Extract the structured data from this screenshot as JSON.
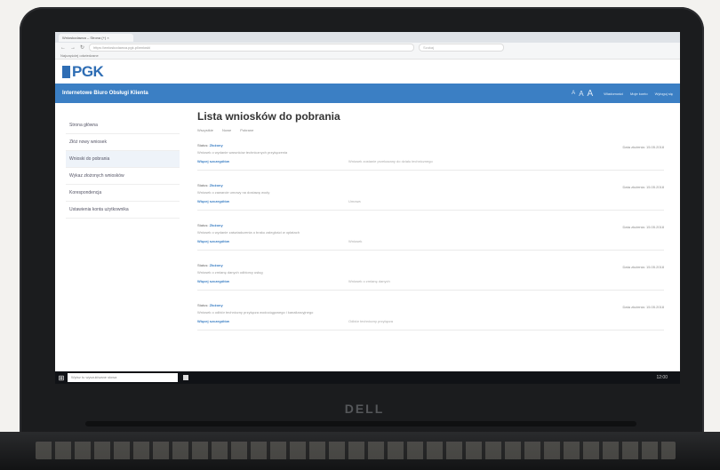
{
  "browser": {
    "tab_title": "Wnioskodawca – Strona (+) ×",
    "url": "https://wnioskodawca.pgk.pl/wnioski",
    "search_placeholder": "Szukaj",
    "bookmarks_label": "Najczęściej odwiedzane"
  },
  "app": {
    "logo": "PGK",
    "header_title": "Internetowe Biuro Obsługi Klienta",
    "font_controls": [
      "A",
      "A",
      "A"
    ],
    "top_links": [
      "Wiadomości",
      "Moje konto",
      "Wyloguj się"
    ]
  },
  "sidebar": {
    "items": [
      {
        "label": "Strona główna"
      },
      {
        "label": "Złóż nowy wniosek"
      },
      {
        "label": "Wnioski do pobrania"
      },
      {
        "label": "Wykaz złożonych wniosków"
      },
      {
        "label": "Korespondencja"
      },
      {
        "label": "Ustawienia konta użytkownika"
      }
    ]
  },
  "main": {
    "title": "Lista wniosków do pobrania",
    "filters": [
      "Wszystkie",
      "Nowe",
      "Pobrane"
    ],
    "rows": [
      {
        "status_label": "Status:",
        "status": "Złożony",
        "date": "Data złożenia: 15.05.2018",
        "description": "Wniosek o wydanie warunków technicznych przyłączenia",
        "link": "Więcej szczegółów",
        "detail": "Wniosek zostanie przekazany do działu technicznego"
      },
      {
        "status_label": "Status:",
        "status": "Złożony",
        "date": "Data złożenia: 15.05.2018",
        "description": "Wniosek o zawarcie umowy na dostawę wody",
        "link": "Więcej szczegółów",
        "detail": "Umowa"
      },
      {
        "status_label": "Status:",
        "status": "Złożony",
        "date": "Data złożenia: 15.05.2018",
        "description": "Wniosek o wydanie zaświadczenia o braku zaległości w opłatach",
        "link": "Więcej szczegółów",
        "detail": "Wniosek"
      },
      {
        "status_label": "Status:",
        "status": "Złożony",
        "date": "Data złożenia: 15.05.2018",
        "description": "Wniosek o zmianę danych odbiorcy usług",
        "link": "Więcej szczegółów",
        "detail": "Wniosek o zmianę danych"
      },
      {
        "status_label": "Status:",
        "status": "Złożony",
        "date": "Data złożenia: 15.05.2018",
        "description": "Wniosek o odbiór techniczny przyłącza wodociągowego i kanalizacyjnego",
        "link": "Więcej szczegółów",
        "detail": "Odbiór techniczny przyłącza"
      }
    ]
  },
  "taskbar": {
    "search_placeholder": "Wpisz tu wyszukiwane słowa",
    "tray": "12:00"
  },
  "device": {
    "brand": "DELL"
  }
}
